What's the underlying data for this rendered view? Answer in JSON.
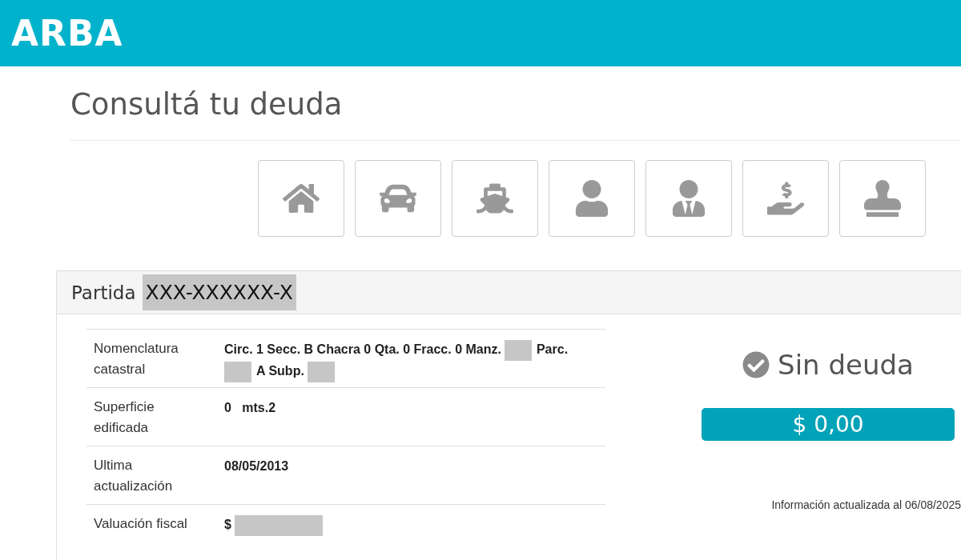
{
  "header": {
    "logo": "ARBA"
  },
  "title": "Consultá tu deuda",
  "categories": [
    {
      "kind": "home"
    },
    {
      "kind": "car"
    },
    {
      "kind": "ship"
    },
    {
      "kind": "person"
    },
    {
      "kind": "businessman"
    },
    {
      "kind": "payment"
    },
    {
      "kind": "stamp"
    }
  ],
  "panel": {
    "label": "Partida",
    "number": "XXX-XXXXXX-X",
    "rows": [
      {
        "label": "Nomenclatura catastral",
        "value": [
          {
            "kind": "text",
            "text": "Circ. 1 Secc. B Chacra 0 Qta. 0 Fracc. 0 Manz."
          },
          {
            "kind": "redacted"
          },
          {
            "kind": "text",
            "text": "Parc."
          },
          {
            "kind": "redacted"
          },
          {
            "kind": "text",
            "text": "A Subp."
          },
          {
            "kind": "redacted"
          }
        ]
      },
      {
        "label": "Superficie edificada",
        "value": [
          {
            "kind": "text",
            "text": "0   mts.2"
          }
        ]
      },
      {
        "label": "Ultima actualización",
        "value": [
          {
            "kind": "text",
            "text": "08/05/2013"
          }
        ]
      },
      {
        "label": "Valuación fiscal",
        "value": [
          {
            "kind": "text",
            "text": "$"
          },
          {
            "kind": "redacted",
            "wide": true
          }
        ]
      }
    ],
    "status": {
      "text": "Sin deuda",
      "amount": "$ 0,00",
      "updated": "Información actualizada al 06/08/2025"
    }
  }
}
